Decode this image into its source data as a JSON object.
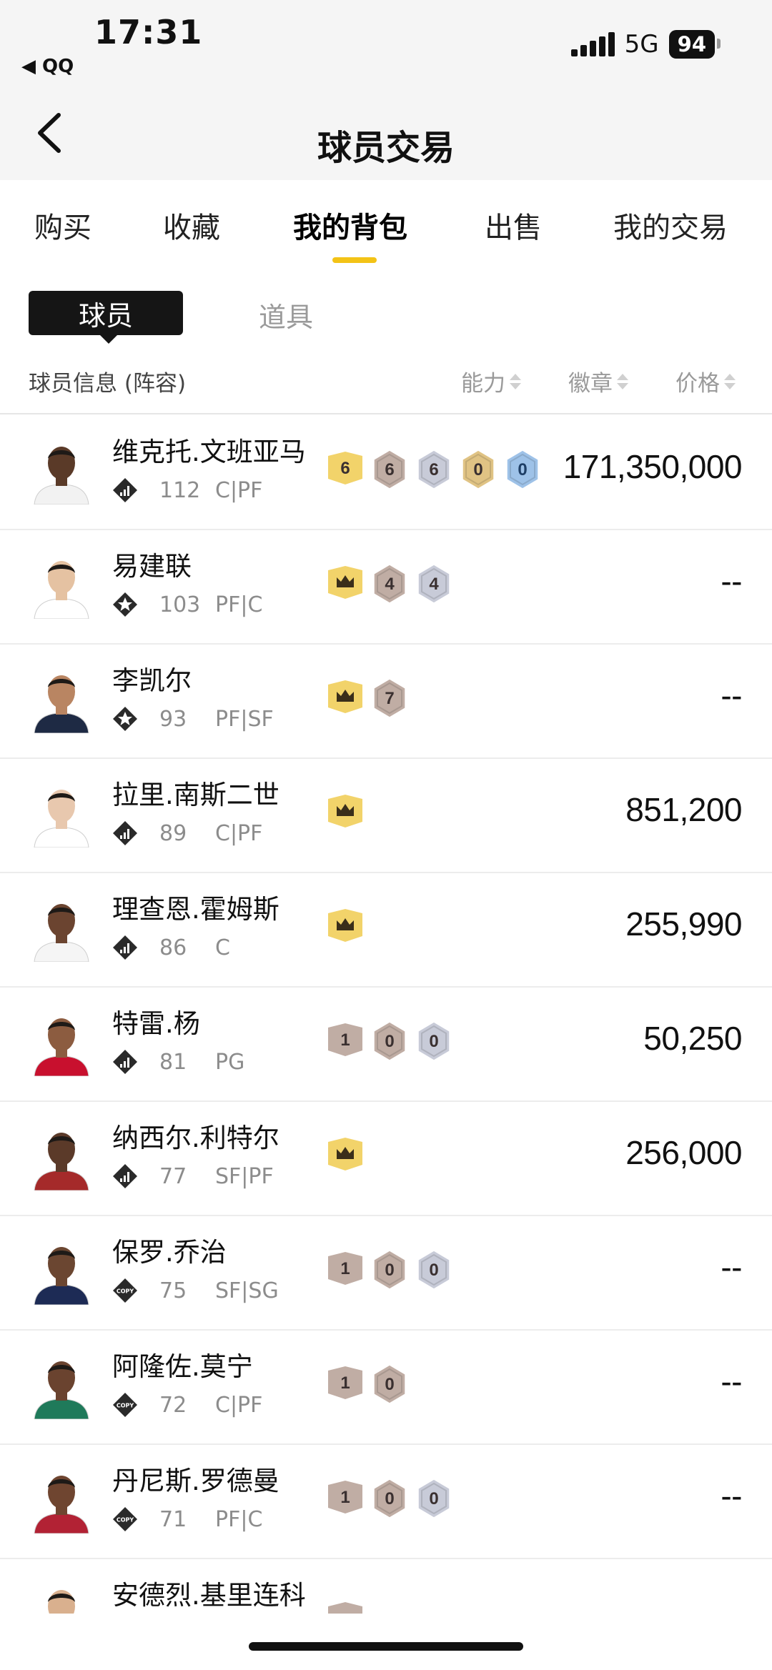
{
  "status_bar": {
    "time": "17:31",
    "back_app": "◀ QQ",
    "network": "5G",
    "battery": "94"
  },
  "nav": {
    "title": "球员交易"
  },
  "tabs": [
    {
      "label": "购买",
      "active": false
    },
    {
      "label": "收藏",
      "active": false
    },
    {
      "label": "我的背包",
      "active": true
    },
    {
      "label": "出售",
      "active": false
    },
    {
      "label": "我的交易",
      "active": false
    }
  ],
  "subtabs": {
    "active": "球员",
    "inactive": "道具"
  },
  "columns": {
    "info": "球员信息 (阵容)",
    "ability": "能力",
    "badge": "徽章",
    "price": "价格"
  },
  "colors": {
    "accent": "#f3c316",
    "gold_badge": "#f2d36a",
    "bronze_badge": "#c0ada4",
    "silver_badge": "#c8cbd8",
    "hof_badge": "#e0c384",
    "blue_badge": "#9ec2e8"
  },
  "players": [
    {
      "name": "维克托.文班亚马",
      "rating": "112",
      "positions": "C|PF",
      "tier": "stats",
      "skin": "#5a3a28",
      "jersey": "#f2f2f2",
      "badges": [
        {
          "type": "gold",
          "label": "6"
        },
        {
          "type": "bronze",
          "label": "6"
        },
        {
          "type": "silver",
          "label": "6"
        },
        {
          "type": "hof",
          "label": "0"
        },
        {
          "type": "blue",
          "label": "0"
        }
      ],
      "price": "171,350,000"
    },
    {
      "name": "易建联",
      "rating": "103",
      "positions": "PF|C",
      "tier": "star",
      "skin": "#e5c2a2",
      "jersey": "#ffffff",
      "badges": [
        {
          "type": "crown",
          "label": ""
        },
        {
          "type": "bronze",
          "label": "4"
        },
        {
          "type": "silver",
          "label": "4"
        }
      ],
      "price": "--"
    },
    {
      "name": "李凯尔",
      "rating": "93",
      "positions": "PF|SF",
      "tier": "star",
      "skin": "#b98562",
      "jersey": "#1e2a44",
      "badges": [
        {
          "type": "crown",
          "label": ""
        },
        {
          "type": "bronze",
          "label": "7"
        }
      ],
      "price": "--"
    },
    {
      "name": "拉里.南斯二世",
      "rating": "89",
      "positions": "C|PF",
      "tier": "stats",
      "skin": "#e8c8ae",
      "jersey": "#ffffff",
      "badges": [
        {
          "type": "crown",
          "label": ""
        }
      ],
      "price": "851,200"
    },
    {
      "name": "理查恩.霍姆斯",
      "rating": "86",
      "positions": "C",
      "tier": "stats",
      "skin": "#6b4430",
      "jersey": "#f5f5f5",
      "badges": [
        {
          "type": "crown",
          "label": ""
        }
      ],
      "price": "255,990"
    },
    {
      "name": "特雷.杨",
      "rating": "81",
      "positions": "PG",
      "tier": "stats",
      "skin": "#8c5c40",
      "jersey": "#c8102e",
      "badges": [
        {
          "type": "bronze-flag",
          "label": "1"
        },
        {
          "type": "bronze",
          "label": "0"
        },
        {
          "type": "silver",
          "label": "0"
        }
      ],
      "price": "50,250"
    },
    {
      "name": "纳西尔.利特尔",
      "rating": "77",
      "positions": "SF|PF",
      "tier": "stats",
      "skin": "#5b3a29",
      "jersey": "#a52a2a",
      "badges": [
        {
          "type": "crown",
          "label": ""
        }
      ],
      "price": "256,000"
    },
    {
      "name": "保罗.乔治",
      "rating": "75",
      "positions": "SF|SG",
      "tier": "copy",
      "skin": "#6b4631",
      "jersey": "#1d2b55",
      "badges": [
        {
          "type": "bronze-flag",
          "label": "1"
        },
        {
          "type": "bronze",
          "label": "0"
        },
        {
          "type": "silver",
          "label": "0"
        }
      ],
      "price": "--"
    },
    {
      "name": "阿隆佐.莫宁",
      "rating": "72",
      "positions": "C|PF",
      "tier": "copy",
      "skin": "#6a432f",
      "jersey": "#1f7a5a",
      "badges": [
        {
          "type": "bronze-flag",
          "label": "1"
        },
        {
          "type": "bronze",
          "label": "0"
        }
      ],
      "price": "--"
    },
    {
      "name": "丹尼斯.罗德曼",
      "rating": "71",
      "positions": "PF|C",
      "tier": "copy",
      "skin": "#6f4530",
      "jersey": "#b22234",
      "badges": [
        {
          "type": "bronze-flag",
          "label": "1"
        },
        {
          "type": "bronze",
          "label": "0"
        },
        {
          "type": "silver",
          "label": "0"
        }
      ],
      "price": "--"
    },
    {
      "name": "安德烈.基里连科",
      "rating": "",
      "positions": "",
      "tier": "",
      "skin": "#d9b08e",
      "jersey": "#ffffff",
      "badges": [
        {
          "type": "bronze-flag",
          "label": ""
        }
      ],
      "price": "",
      "partial": true
    }
  ]
}
